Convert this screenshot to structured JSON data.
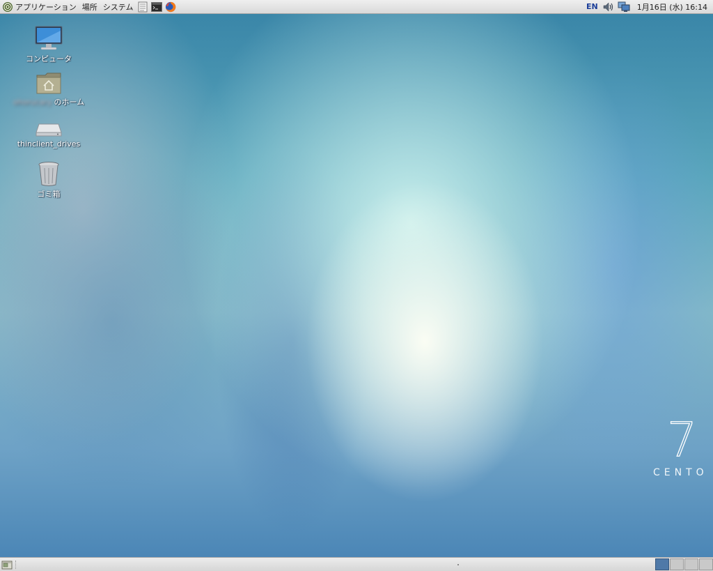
{
  "top_panel": {
    "menus": [
      {
        "label": "アプリケーション"
      },
      {
        "label": "場所"
      },
      {
        "label": "システム"
      }
    ],
    "launchers": [
      "text-editor-icon",
      "terminal-icon",
      "firefox-icon"
    ],
    "language": "EN",
    "tray_icons": [
      "volume-icon",
      "network-icon"
    ],
    "clock": "1月16日 (水) 16:14"
  },
  "desktop": {
    "icons": [
      {
        "name": "computer-icon",
        "label": "コンピュータ"
      },
      {
        "name": "home-folder-icon",
        "label_prefix": "ohorucary",
        "label": "のホーム"
      },
      {
        "name": "drive-icon",
        "label": "thinclient_drives"
      },
      {
        "name": "trash-icon",
        "label": "ゴミ箱"
      }
    ],
    "branding": {
      "number": "7",
      "text": "CENTO"
    }
  },
  "bottom_panel": {
    "workspaces": [
      {
        "active": true
      },
      {
        "active": false
      },
      {
        "active": false
      },
      {
        "active": false
      }
    ]
  },
  "colors": {
    "panel": "#e2e2e2",
    "workspace_active": "#4f79a8",
    "language_indicator": "#1c3f9a"
  }
}
